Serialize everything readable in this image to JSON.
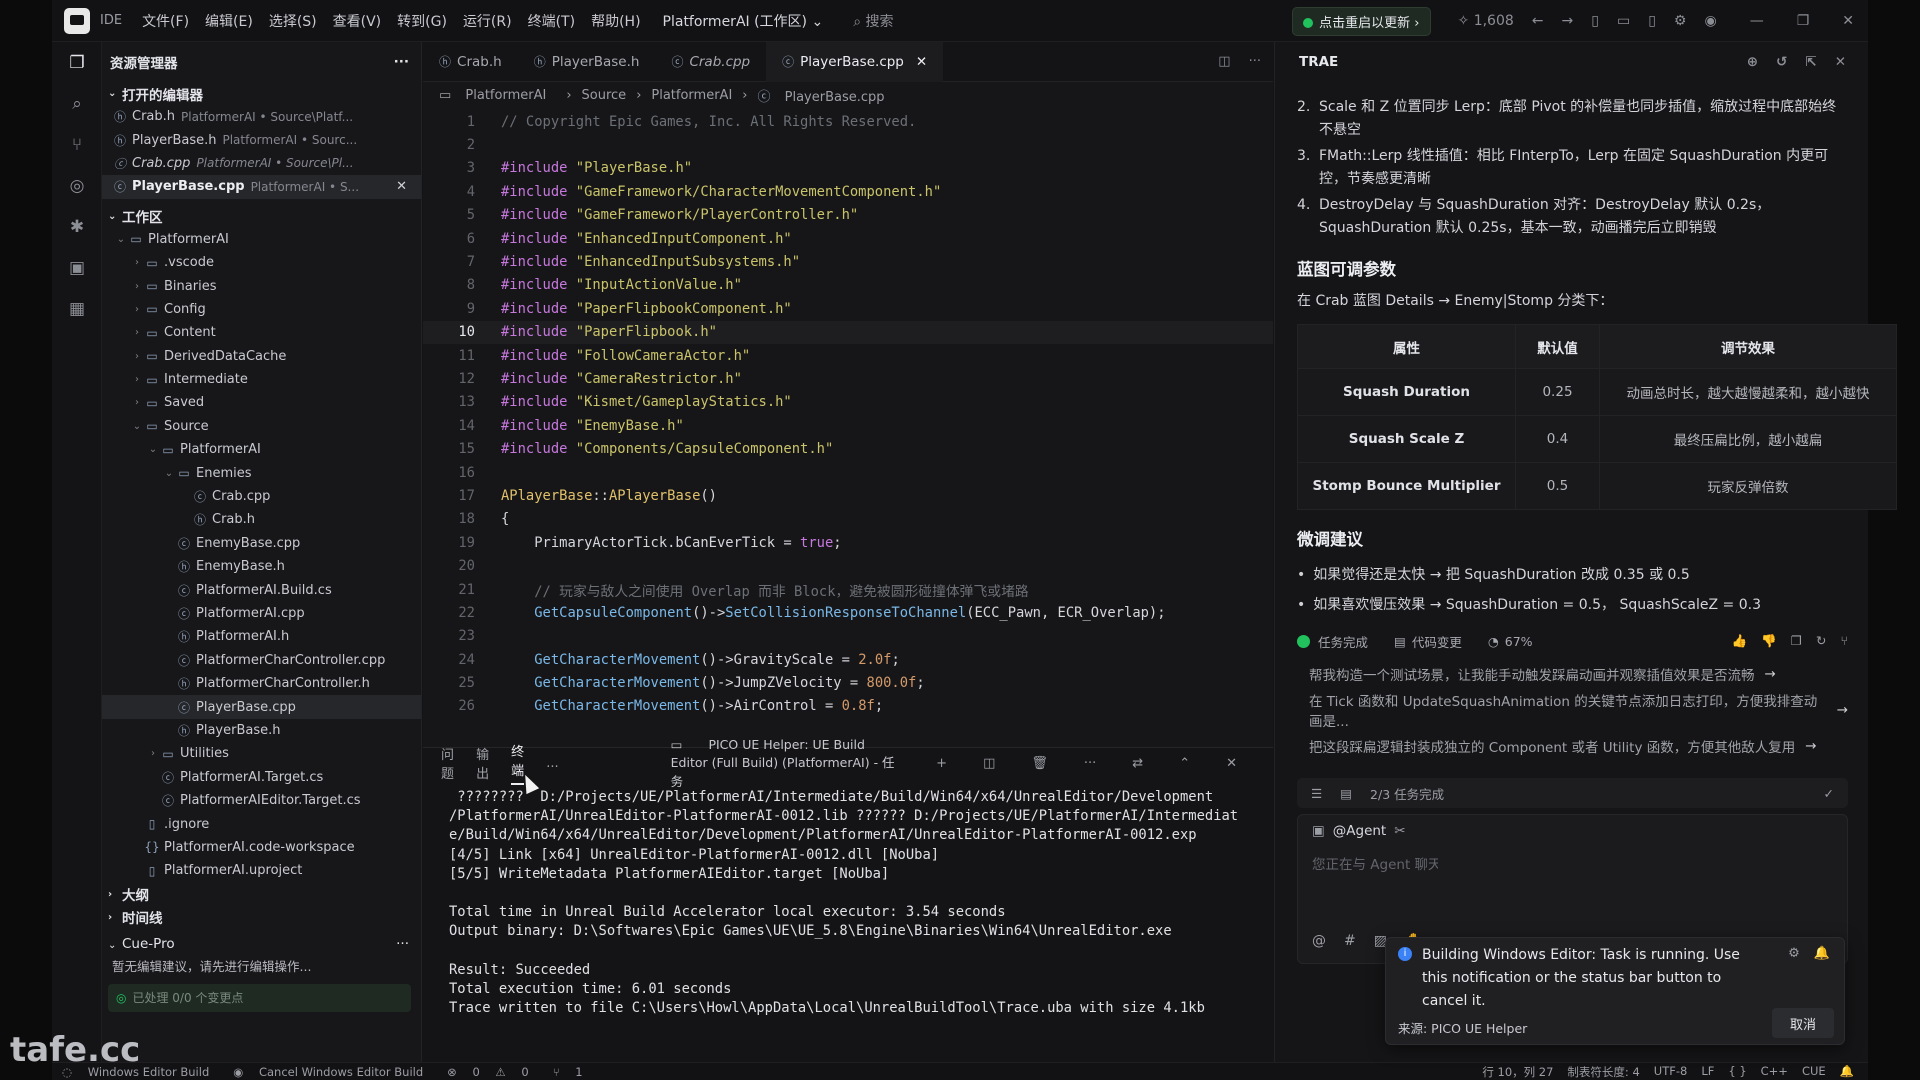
{
  "titlebar": {
    "ide": "IDE",
    "menu": [
      "文件(F)",
      "编辑(E)",
      "选择(S)",
      "查看(V)",
      "转到(G)",
      "运行(R)",
      "终端(T)",
      "帮助(H)"
    ],
    "workspace": "PlatformerAI (工作区)",
    "search": "搜索",
    "update_btn": "点击重启以更新",
    "counter": "1,608"
  },
  "sidebar": {
    "title": "资源管理器",
    "open_editors_title": "打开的编辑器",
    "open_editors": [
      {
        "name": "Crab.h",
        "path": "PlatformerAI • Source\\Platf..."
      },
      {
        "name": "PlayerBase.h",
        "path": "PlatformerAI • Sourc..."
      },
      {
        "name": "Crab.cpp",
        "path": "PlatformerAI • Source\\Pl..."
      },
      {
        "name": "PlayerBase.cpp",
        "path": "PlatformerAI • S..."
      }
    ],
    "workspace_title": "工作区",
    "tree": [
      {
        "d": 0,
        "n": "PlatformerAI",
        "t": "folder-open"
      },
      {
        "d": 1,
        "n": ".vscode",
        "t": "folder"
      },
      {
        "d": 1,
        "n": "Binaries",
        "t": "folder"
      },
      {
        "d": 1,
        "n": "Config",
        "t": "folder"
      },
      {
        "d": 1,
        "n": "Content",
        "t": "folder"
      },
      {
        "d": 1,
        "n": "DerivedDataCache",
        "t": "folder"
      },
      {
        "d": 1,
        "n": "Intermediate",
        "t": "folder"
      },
      {
        "d": 1,
        "n": "Saved",
        "t": "folder"
      },
      {
        "d": 1,
        "n": "Source",
        "t": "folder-open"
      },
      {
        "d": 2,
        "n": "PlatformerAI",
        "t": "folder-open"
      },
      {
        "d": 3,
        "n": "Enemies",
        "t": "folder-open"
      },
      {
        "d": 4,
        "n": "Crab.cpp",
        "t": "cpp"
      },
      {
        "d": 4,
        "n": "Crab.h",
        "t": "h"
      },
      {
        "d": 3,
        "n": "EnemyBase.cpp",
        "t": "cpp"
      },
      {
        "d": 3,
        "n": "EnemyBase.h",
        "t": "h"
      },
      {
        "d": 3,
        "n": "PlatformerAI.Build.cs",
        "t": "cs"
      },
      {
        "d": 3,
        "n": "PlatformerAI.cpp",
        "t": "cpp"
      },
      {
        "d": 3,
        "n": "PlatformerAI.h",
        "t": "h"
      },
      {
        "d": 3,
        "n": "PlatformerCharController.cpp",
        "t": "cpp"
      },
      {
        "d": 3,
        "n": "PlatformerCharController.h",
        "t": "h"
      },
      {
        "d": 3,
        "n": "PlayerBase.cpp",
        "t": "cpp"
      },
      {
        "d": 3,
        "n": "PlayerBase.h",
        "t": "h"
      },
      {
        "d": 2,
        "n": "Utilities",
        "t": "folder"
      },
      {
        "d": 2,
        "n": "PlatformerAI.Target.cs",
        "t": "cs"
      },
      {
        "d": 2,
        "n": "PlatformerAIEditor.Target.cs",
        "t": "cs"
      },
      {
        "d": 1,
        "n": ".ignore",
        "t": "file"
      },
      {
        "d": 1,
        "n": "PlatformerAI.code-workspace",
        "t": "json"
      },
      {
        "d": 1,
        "n": "PlatformerAI.uproject",
        "t": "file"
      }
    ],
    "outline": "大纲",
    "timeline": "时间线",
    "cue_title": "Cue-Pro",
    "cue_msg": "暂无编辑建议，请先进行编辑操作...",
    "cue_status": "已处理 0/0 个变更点"
  },
  "editor": {
    "tabs": [
      "Crab.h",
      "PlayerBase.h",
      "Crab.cpp",
      "PlayerBase.cpp"
    ],
    "breadcrumb": [
      "PlatformerAI",
      "Source",
      "PlatformerAI",
      "PlayerBase.cpp"
    ],
    "lines": [
      "// Copyright Epic Games, Inc. All Rights Reserved.",
      "",
      "#include \"PlayerBase.h\"",
      "#include \"GameFramework/CharacterMovementComponent.h\"",
      "#include \"GameFramework/PlayerController.h\"",
      "#include \"EnhancedInputComponent.h\"",
      "#include \"EnhancedInputSubsystems.h\"",
      "#include \"InputActionValue.h\"",
      "#include \"PaperFlipbookComponent.h\"",
      "#include \"PaperFlipbook.h\"",
      "#include \"FollowCameraActor.h\"",
      "#include \"CameraRestrictor.h\"",
      "#include \"Kismet/GameplayStatics.h\"",
      "#include \"EnemyBase.h\"",
      "#include \"Components/CapsuleComponent.h\"",
      "",
      "APlayerBase::APlayerBase()",
      "{",
      "    PrimaryActorTick.bCanEverTick = true;",
      "",
      "    // 玩家与敌人之间使用 Overlap 而非 Block，避免被圆形碰撞体弹飞或堵路",
      "    GetCapsuleComponent()->SetCollisionResponseToChannel(ECC_Pawn, ECR_Overlap);",
      "",
      "    GetCharacterMovement()->GravityScale = 2.0f;",
      "    GetCharacterMovement()->JumpZVelocity = 800.0f;",
      "    GetCharacterMovement()->AirControl = 0.8f;"
    ]
  },
  "panel": {
    "tabs": [
      "问题",
      "输出",
      "终端",
      "..."
    ],
    "task": "PICO UE Helper: UE Build Editor (Full Build) (PlatformerAI) - 任务",
    "terminal": " ????????  D:/Projects/UE/PlatformerAI/Intermediate/Build/Win64/x64/UnrealEditor/Development\n/PlatformerAI/UnrealEditor-PlatformerAI-0012.lib ?????? D:/Projects/UE/PlatformerAI/Intermediat\ne/Build/Win64/x64/UnrealEditor/Development/PlatformerAI/UnrealEditor-PlatformerAI-0012.exp\n[4/5] Link [x64] UnrealEditor-PlatformerAI-0012.dll [NoUba]\n[5/5] WriteMetadata PlatformerAIEditor.target [NoUba]\n\nTotal time in Unreal Build Accelerator local executor: 3.54 seconds\nOutput binary: D:\\Softwares\\Epic Games\\UE\\UE_5.8\\Engine\\Binaries\\Win64\\UnrealEditor.exe\n\nResult: Succeeded\nTotal execution time: 6.01 seconds\nTrace written to file C:\\Users\\Howl\\AppData\\Local\\UnrealBuildTool\\Trace.uba with size 4.1kb"
  },
  "right": {
    "title": "TRAE",
    "items": [
      {
        "n": "2.",
        "t": "Scale 和 Z 位置同步 Lerp：底部 Pivot 的补偿量也同步插值，缩放过程中底部始终不悬空"
      },
      {
        "n": "3.",
        "t": "FMath::Lerp 线性插值：相比 FInterpTo，Lerp 在固定 SquashDuration 内更可控，节奏感更清晰"
      },
      {
        "n": "4.",
        "t": "DestroyDelay 与 SquashDuration 对齐：DestroyDelay 默认 0.2s，SquashDuration 默认 0.25s，基本一致，动画播完后立即销毁"
      }
    ],
    "h_params": "蓝图可调参数",
    "params_intro": "在 Crab 蓝图 Details → Enemy|Stomp 分类下：",
    "table_head": [
      "属性",
      "默认值",
      "调节效果"
    ],
    "table_rows": [
      [
        "Squash Duration",
        "0.25",
        "动画总时长，越大越慢越柔和，越小越快"
      ],
      [
        "Squash Scale Z",
        "0.4",
        "最终压扁比例，越小越扁"
      ],
      [
        "Stomp Bounce Multiplier",
        "0.5",
        "玩家反弹倍数"
      ]
    ],
    "h_tips": "微调建议",
    "tips": [
      "如果觉得还是太快 → 把 SquashDuration 改成 0.35 或 0.5",
      "如果喜欢慢压效果 → SquashDuration = 0.5， SquashScaleZ = 0.3"
    ],
    "status": [
      "任务完成",
      "代码变更",
      "67%"
    ],
    "suggestions": [
      "帮我构造一个测试场景，让我能手动触发踩扁动画并观察插值效果是否流畅",
      "在 Tick 函数和 UpdateSquashAnimation 的关键节点添加日志打印，方便我排查动画是...",
      "把这段踩扁逻辑封装成独立的 Component 或者 Utility 函数，方便其他敌人复用"
    ],
    "todo": "2/3 任务完成",
    "agent": "@Agent",
    "placeholder": "您正在与 Agent 聊天，输入 / 以获取更多命令，输入 @ 引用上下文"
  },
  "toast": {
    "text": "Building Windows Editor: Task is running. Use this notification or the status bar button to cancel it.",
    "source": "来源: PICO UE Helper",
    "button": "取消"
  },
  "statusbar": {
    "left": [
      "Windows Editor Build",
      "Cancel Windows Editor Build",
      "0",
      "0",
      "1"
    ],
    "right": [
      "行 10，列 27",
      "制表符长度: 4",
      "UTF-8",
      "LF",
      "{ }",
      "C++",
      "CUE"
    ]
  },
  "watermark": "tafe.cc"
}
